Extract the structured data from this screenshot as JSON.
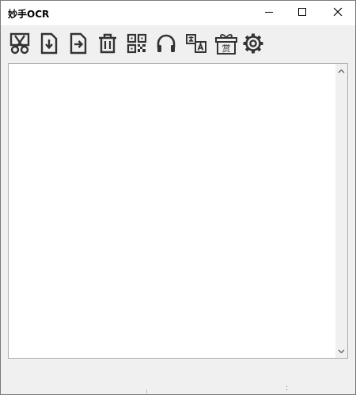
{
  "window": {
    "title": "妙手OCR"
  },
  "caption_buttons": [
    {
      "name": "minimize",
      "icon": "minimize-icon"
    },
    {
      "name": "maximize",
      "icon": "maximize-icon"
    },
    {
      "name": "close",
      "icon": "close-icon"
    }
  ],
  "toolbar": {
    "buttons": [
      {
        "icon": "scissors-icon"
      },
      {
        "icon": "file-import-icon"
      },
      {
        "icon": "file-export-icon"
      },
      {
        "icon": "trash-icon"
      },
      {
        "icon": "qr-code-icon"
      },
      {
        "icon": "headphones-icon"
      },
      {
        "icon": "translate-icon"
      },
      {
        "icon": "reward-gift-icon",
        "text": "赏"
      },
      {
        "icon": "gear-icon"
      }
    ]
  },
  "main": {
    "text_value": ""
  },
  "status": {
    "left_text": "",
    "right_text": ""
  },
  "colors": {
    "window_bg": "#f0f0f0",
    "titlebar_bg": "#ffffff",
    "icon_color": "#333333",
    "text_border": "#adadad"
  }
}
